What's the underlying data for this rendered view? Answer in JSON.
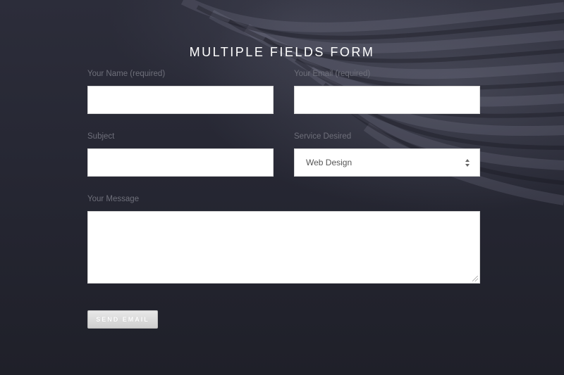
{
  "form": {
    "title": "MULTIPLE FIELDS FORM",
    "name_label": "Your Name (required)",
    "name_value": "",
    "email_label": "Your Email (required)",
    "email_value": "",
    "subject_label": "Subject",
    "subject_value": "",
    "service_label": "Service Desired",
    "service_selected": "Web Design",
    "message_label": "Your Message",
    "message_value": "",
    "send_label": "SEND EMAIL"
  },
  "icons": {
    "select_arrows": "select-arrows-icon",
    "resize_grip": "resize-grip-icon"
  },
  "colors": {
    "background": "#22232e",
    "field_bg": "#ffffff",
    "label_text": "#6e6f7a",
    "title_text": "#ffffff",
    "button_bg": "#d9d9d9"
  }
}
